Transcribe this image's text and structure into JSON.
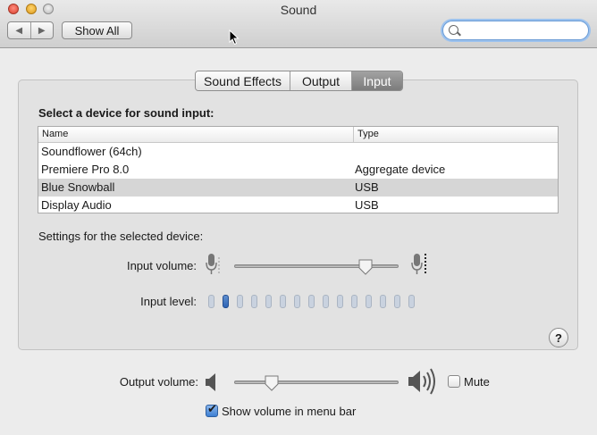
{
  "window": {
    "title": "Sound"
  },
  "toolbar": {
    "show_all_label": "Show All",
    "search_placeholder": ""
  },
  "tabs": [
    {
      "label": "Sound Effects",
      "selected": false
    },
    {
      "label": "Output",
      "selected": false
    },
    {
      "label": "Input",
      "selected": true
    }
  ],
  "input": {
    "section_label": "Select a device for sound input:",
    "columns": [
      "Name",
      "Type"
    ],
    "devices": [
      {
        "name": "Soundflower (64ch)",
        "type": "",
        "selected": false
      },
      {
        "name": "Premiere Pro 8.0",
        "type": "Aggregate device",
        "selected": false
      },
      {
        "name": "Blue Snowball",
        "type": "USB",
        "selected": true
      },
      {
        "name": "Display Audio",
        "type": "USB",
        "selected": false
      }
    ],
    "settings_label": "Settings for the selected device:",
    "input_volume_label": "Input volume:",
    "input_volume_level": 0.83,
    "input_level_label": "Input level:",
    "input_level_segments_total": 15,
    "input_level_segments_lit": 2
  },
  "output": {
    "output_volume_label": "Output volume:",
    "output_volume_level": 0.2,
    "mute_label": "Mute",
    "mute_checked": false,
    "show_volume_label": "Show volume in menu bar",
    "show_volume_checked": true
  },
  "help_label": "?",
  "colors": {
    "accent": "#3d7fd3",
    "level_on": "#2e64b4",
    "selected_tab": "#8a8a8a"
  }
}
